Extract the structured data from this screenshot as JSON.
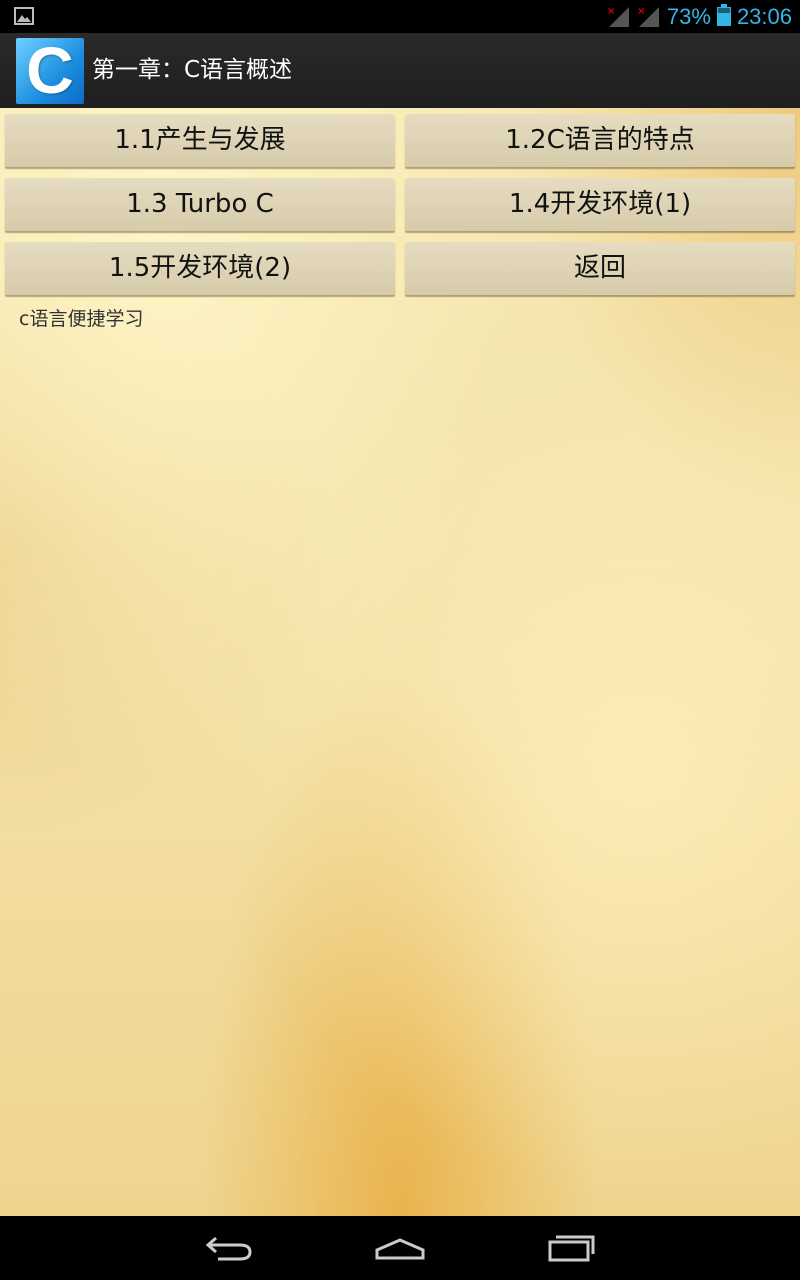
{
  "status_bar": {
    "battery_percent": "73%",
    "time": "23:06",
    "accent_color": "#33b5e5",
    "icons": [
      "image-notification-icon",
      "signal-no-service-icon",
      "signal-no-service-icon",
      "battery-icon"
    ]
  },
  "action_bar": {
    "app_icon_letter": "C",
    "title": "第一章：C语言概述"
  },
  "menu": {
    "buttons": [
      {
        "label": "1.1产生与发展"
      },
      {
        "label": "1.2C语言的特点"
      },
      {
        "label": "1.3 Turbo C"
      },
      {
        "label": "1.4开发环境(1)"
      },
      {
        "label": "1.5开发环境(2)"
      },
      {
        "label": "返回"
      }
    ]
  },
  "footer_text": "c语言便捷学习",
  "nav_bar": {
    "icons": [
      "back-icon",
      "home-icon",
      "recent-apps-icon"
    ]
  }
}
